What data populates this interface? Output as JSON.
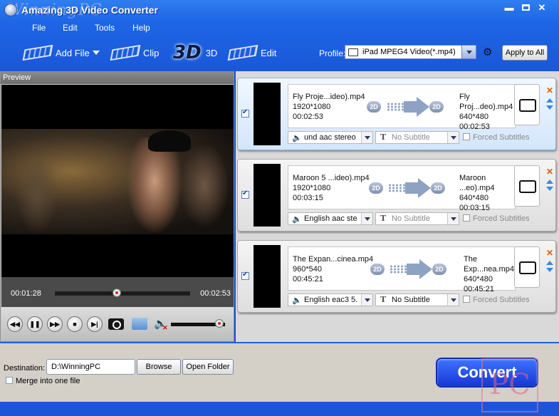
{
  "window": {
    "title": "Amazing 3D Video Converter",
    "watermark": "WinningPC",
    "min": "▬",
    "close": "✕"
  },
  "menu": [
    "File",
    "Edit",
    "Tools",
    "Help"
  ],
  "toolbar": {
    "add_file": "Add File",
    "clip": "Clip",
    "three_d": "3D",
    "three_d_badge": "3D",
    "edit": "Edit",
    "profile_label": "Profile:",
    "profile_value": "iPad MPEG4 Video(*.mp4)",
    "apply_all": "Apply to All"
  },
  "preview": {
    "header": "Preview",
    "current_time": "00:01:28",
    "total_time": "00:02:53",
    "seek_progress": 0.45,
    "volume_level": 0.9
  },
  "files": [
    {
      "src_name": "Fly Proje...ideo).mp4",
      "src_res": "1920*1080",
      "src_dur": "00:02:53",
      "dst_name": "Fly Proj...deo).mp4",
      "dst_res": "640*480",
      "dst_dur": "00:02:53",
      "src_mode": "2D",
      "dst_mode": "2D",
      "audio": "und aac stereo",
      "subtitle": "No Subtitle",
      "forced": "Forced Subtitles",
      "selected": true
    },
    {
      "src_name": "Maroon 5 ...ideo).mp4",
      "src_res": "1920*1080",
      "src_dur": "00:03:15",
      "dst_name": "Maroon ...eo).mp4",
      "dst_res": "640*480",
      "dst_dur": "00:03:15",
      "src_mode": "2D",
      "dst_mode": "2D",
      "audio": "English aac ste",
      "subtitle": "No Subtitle",
      "forced": "Forced Subtitles",
      "selected": false
    },
    {
      "src_name": "The Expan...cinea.mp4",
      "src_res": "960*540",
      "src_dur": "00:45:21",
      "dst_name": "The Exp...nea.mp4",
      "dst_res": "640*480",
      "dst_dur": "00:45:21",
      "src_mode": "2D",
      "dst_mode": "2D",
      "audio": "English eac3 5.",
      "subtitle": "No Subtitle",
      "forced": "Forced Subtitles",
      "selected": false
    }
  ],
  "bottom": {
    "destination_label": "Destination:",
    "destination_value": "D:\\WinningPC",
    "browse": "Browse",
    "open_folder": "Open Folder",
    "merge": "Merge into one file",
    "convert": "Convert",
    "pc_mark": "PC"
  },
  "colors": {
    "accent": "#1a57d8",
    "selected_row": "#d3e6fb",
    "convert": "#1636d6"
  },
  "icons": [
    "app-logo-icon",
    "film-icon",
    "3d-icon",
    "magic-wand-icon",
    "ipad-icon",
    "gear-icon",
    "speaker-icon",
    "subtitle-icon",
    "tablet-icon",
    "remove-icon",
    "move-up-icon",
    "move-down-icon",
    "rewind-icon",
    "pause-icon",
    "fast-forward-icon",
    "stop-icon",
    "next-icon",
    "camera-icon",
    "folder-icon",
    "mute-icon"
  ]
}
